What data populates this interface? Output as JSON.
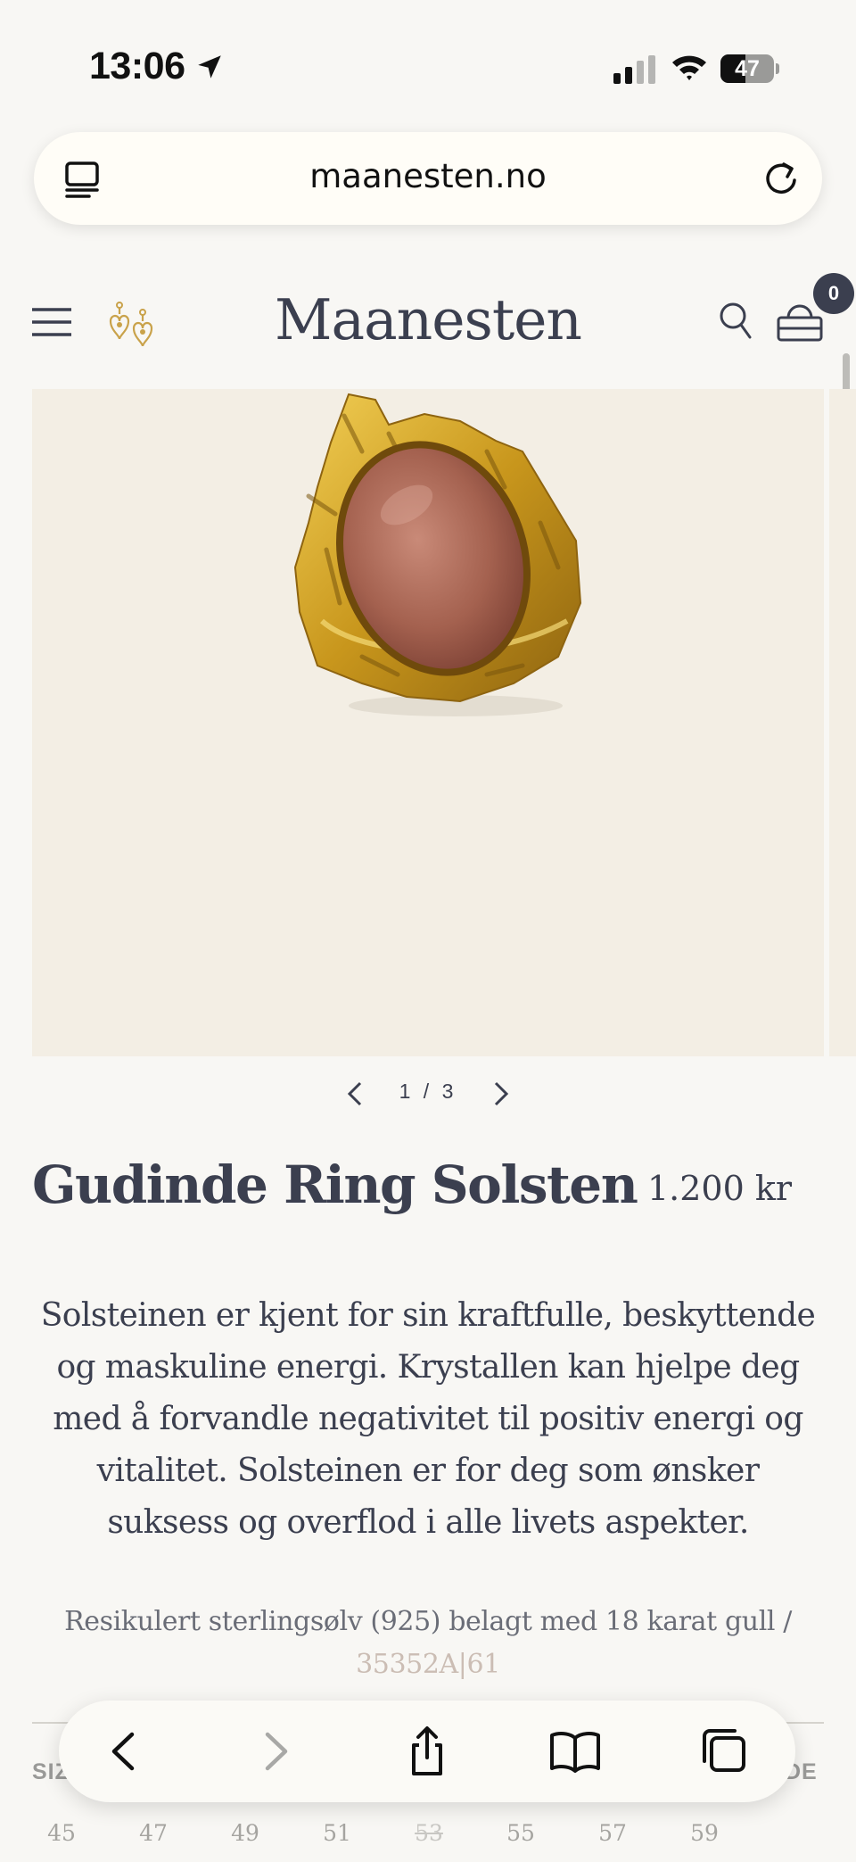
{
  "status_bar": {
    "time": "13:06",
    "battery": "47",
    "battery_level": 0.47
  },
  "browser": {
    "url": "maanesten.no"
  },
  "header": {
    "logo": "Maanesten",
    "cart_count": "0"
  },
  "gallery": {
    "pager_text": "1 / 3",
    "current": 1,
    "total": 3
  },
  "product": {
    "title": "Gudinde Ring Solsten",
    "price": "1.200 kr",
    "description": "Solsteinen er kjent for sin kraftfulle, beskyttende og maskuline energi. Krystallen kan hjelpe deg med å forvandle negativitet til positiv energi og vitalitet. Solsteinen er for deg som ønsker suksess og overflod i alle livets aspekter.",
    "material": "Resikulert sterlingsølv (925) belagt med 18 karat gull /",
    "sku": "35352A|61"
  },
  "sizes": {
    "label": "SIZ",
    "guide": "DE",
    "options": [
      {
        "value": "45",
        "available": true
      },
      {
        "value": "47",
        "available": true
      },
      {
        "value": "49",
        "available": true
      },
      {
        "value": "51",
        "available": true
      },
      {
        "value": "53",
        "available": false
      },
      {
        "value": "55",
        "available": true
      },
      {
        "value": "57",
        "available": true
      },
      {
        "value": "59",
        "available": true
      }
    ]
  },
  "colors": {
    "text_primary": "#3b3f4f",
    "image_bg": "#f3eee4",
    "page_bg": "#f8f7f4"
  }
}
